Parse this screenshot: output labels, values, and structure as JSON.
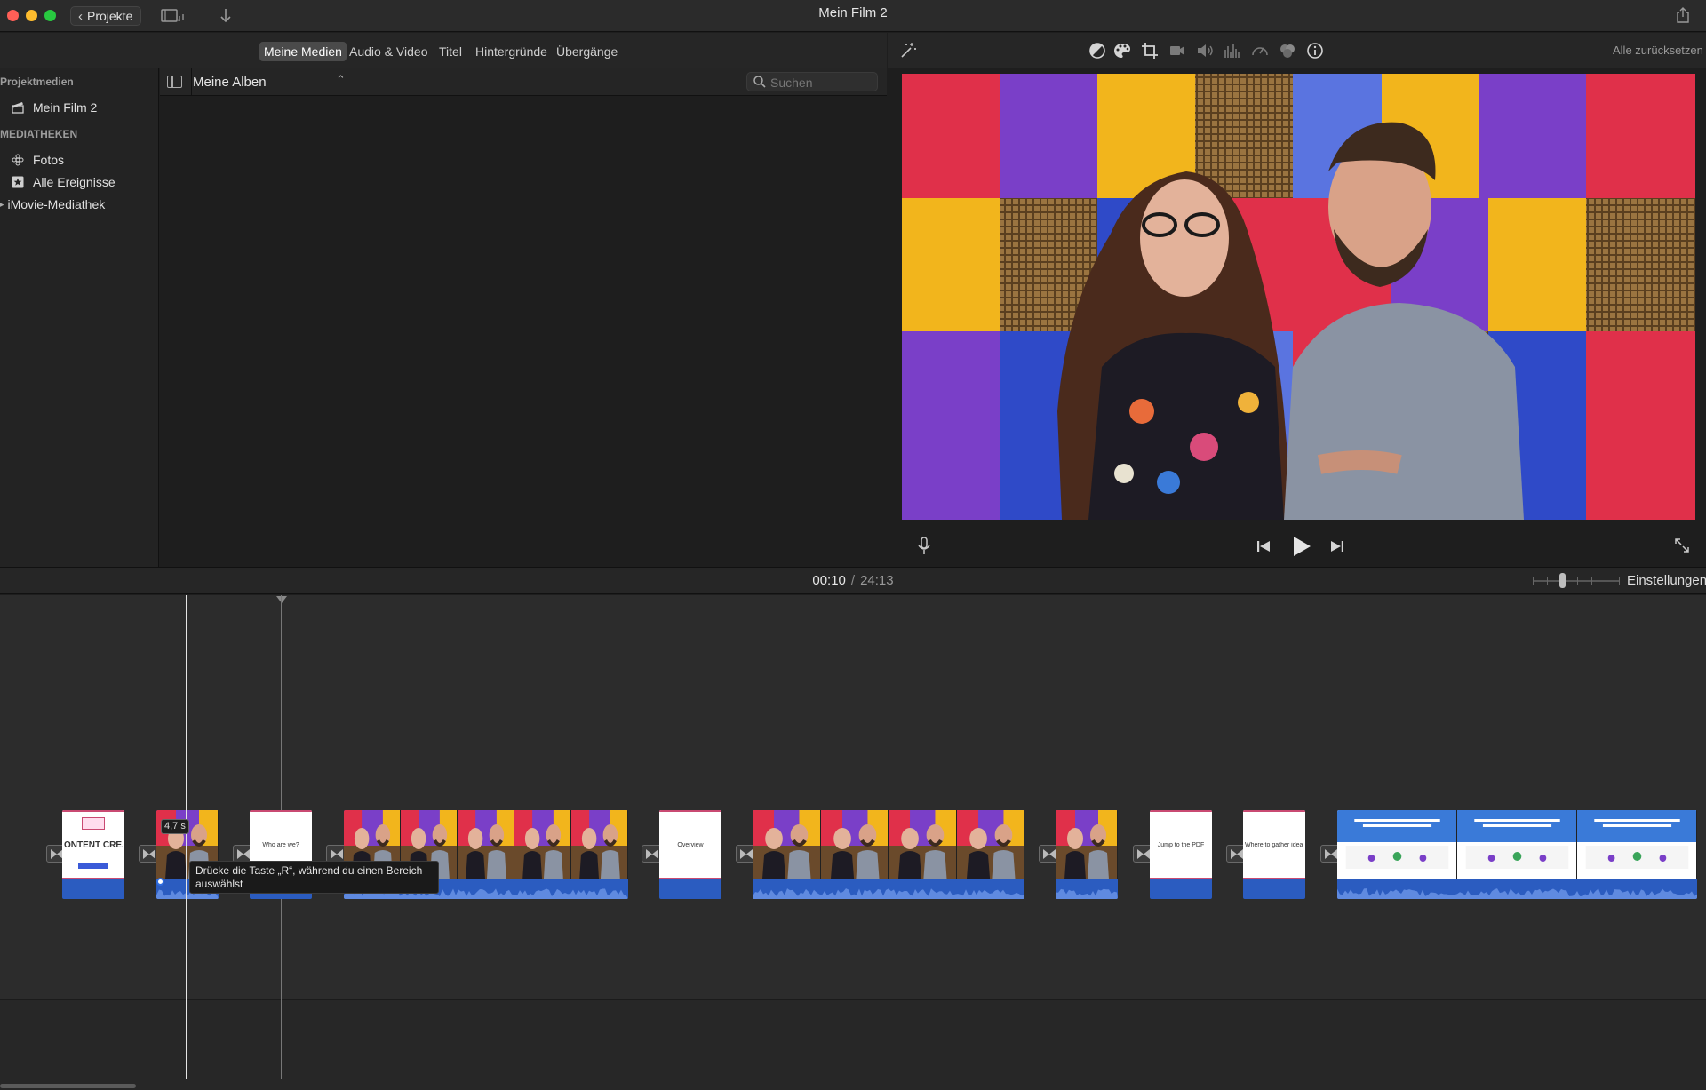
{
  "window": {
    "title": "Mein Film 2",
    "projects_button": "Projekte"
  },
  "browser_tabs": [
    {
      "label": "Meine Medien",
      "active": true
    },
    {
      "label": "Audio & Video",
      "active": false
    },
    {
      "label": "Titel",
      "active": false
    },
    {
      "label": "Hintergründe",
      "active": false
    },
    {
      "label": "Übergänge",
      "active": false
    }
  ],
  "sidebar": {
    "project_media_header": "Projektmedien",
    "project_item": "Mein Film 2",
    "libraries_header": "MEDIATHEKEN",
    "library_items": [
      "Fotos",
      "Alle Ereignisse"
    ],
    "imovie_library": "iMovie-Mediathek"
  },
  "media": {
    "album_selector": "Meine Alben",
    "search_placeholder": "Suchen"
  },
  "viewer": {
    "reset_all": "Alle zurücksetzen",
    "tool_icons": [
      "color-balance-icon",
      "color-correction-icon",
      "crop-icon",
      "stabilization-icon",
      "volume-icon",
      "equalizer-icon",
      "speed-icon",
      "noise-reduction-icon",
      "info-icon"
    ]
  },
  "timeline": {
    "current_time": "00:10",
    "separator": "/",
    "total_time": "24:13",
    "settings_label": "Einstellungen",
    "clip_duration_badge": "4,7 s",
    "tooltip": "Drücke die Taste „R“, während du einen Bereich auswählst",
    "title_cards": [
      "ONTENT CREAT",
      "Who are we?",
      "Overview",
      "Jump to the PDF",
      "Where to gather ideas f"
    ]
  },
  "colors": {
    "audio_track": "#2b5cc0",
    "title_card_border": "#c94a72",
    "accent": "#2f6de0"
  }
}
